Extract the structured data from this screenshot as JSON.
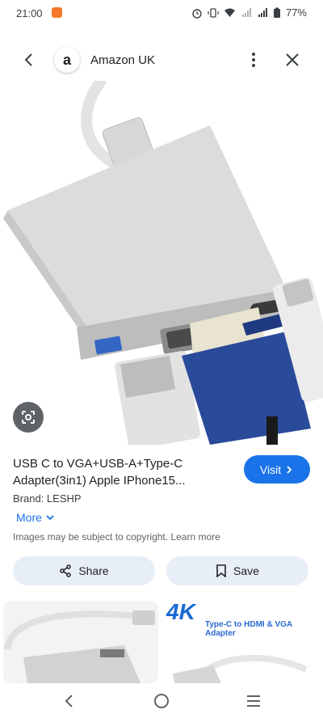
{
  "status": {
    "time": "21:00",
    "battery": "77%",
    "icons": [
      "app-notification-icon",
      "alarm-icon",
      "vibrate-icon",
      "wifi-icon",
      "signal-icon",
      "signal-icon",
      "battery-icon"
    ]
  },
  "header": {
    "site_name": "Amazon UK",
    "logo_letter": "a"
  },
  "product": {
    "title": "USB C to VGA+USB-A+Type-C Adapter(3in1) Apple IPhone15...",
    "brand": "Brand: LESHP",
    "more_label": "More",
    "visit_label": "Visit",
    "copyright": "Images may be subject to copyright. Learn more"
  },
  "actions": {
    "share_label": "Share",
    "save_label": "Save"
  },
  "related": {
    "banner_text": "4K",
    "caption": "Type-C to HDMI & VGA Adapter"
  },
  "colors": {
    "accent": "#1a73e8",
    "pill_bg": "#e8eef8",
    "vga_blue": "#2a4a9a"
  }
}
